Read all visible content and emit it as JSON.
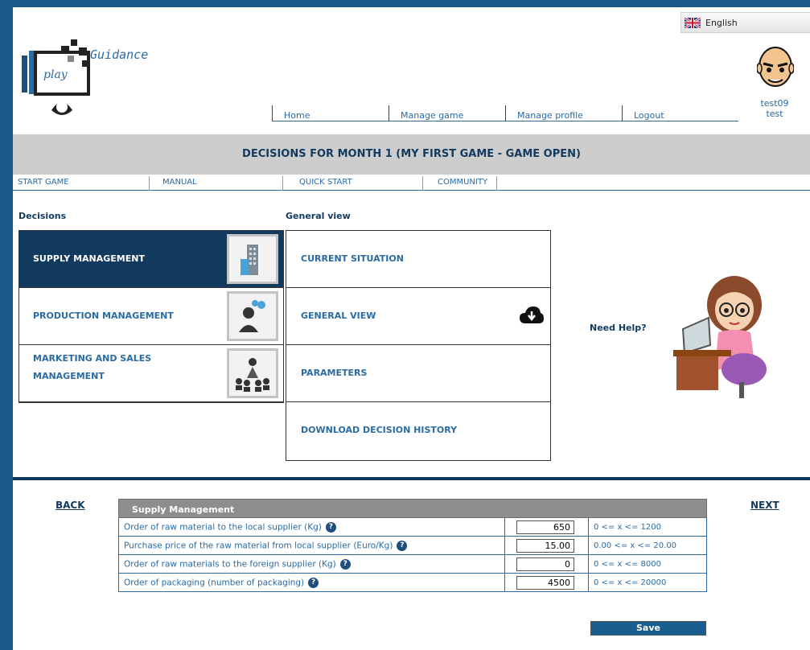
{
  "header": {
    "logo_text": "Guidance",
    "logo_play": "play",
    "language": "English",
    "user": {
      "username": "test09",
      "name": "test"
    },
    "nav": [
      "Home",
      "Manage game",
      "Manage profile",
      "Logout"
    ]
  },
  "title_band": "DECISIONS FOR MONTH 1 (MY FIRST GAME - GAME OPEN)",
  "subnav": [
    "START GAME",
    "MANUAL",
    "QUICK START",
    "COMMUNITY"
  ],
  "decisions": {
    "label": "Decisions",
    "items": [
      {
        "label": "SUPPLY MANAGEMENT",
        "icon": "building-icon"
      },
      {
        "label": "PRODUCTION MANAGEMENT",
        "icon": "worker-icon"
      },
      {
        "label": "MARKETING AND SALES MANAGEMENT",
        "icon": "audience-icon"
      }
    ]
  },
  "general_view": {
    "label": "General view",
    "items": [
      "CURRENT SITUATION",
      "GENERAL VIEW",
      "PARAMETERS",
      "DOWNLOAD DECISION HISTORY"
    ]
  },
  "help": {
    "label": "Need Help?"
  },
  "form": {
    "back": "BACK",
    "next": "NEXT",
    "title": "Supply Management",
    "help_glyph": "?",
    "rows": [
      {
        "question": "Order of raw material to the local supplier (Kg)",
        "value": "650",
        "range": "0 <= x <= 1200"
      },
      {
        "question": "Purchase price of the raw material from local supplier (Euro/Kg)",
        "value": "15.00",
        "range": "0.00 <= x <= 20.00"
      },
      {
        "question": "Order of raw materials to the foreign supplier (Kg)",
        "value": "0",
        "range": "0 <= x <= 8000"
      },
      {
        "question": "Order of packaging (number of packaging)",
        "value": "4500",
        "range": "0 <= x <= 20000"
      }
    ],
    "save": "Save"
  },
  "colors": {
    "navy": "#123a5e",
    "link": "#2a6ba3",
    "band": "#cdcdcd",
    "save": "#1a5d8f"
  }
}
